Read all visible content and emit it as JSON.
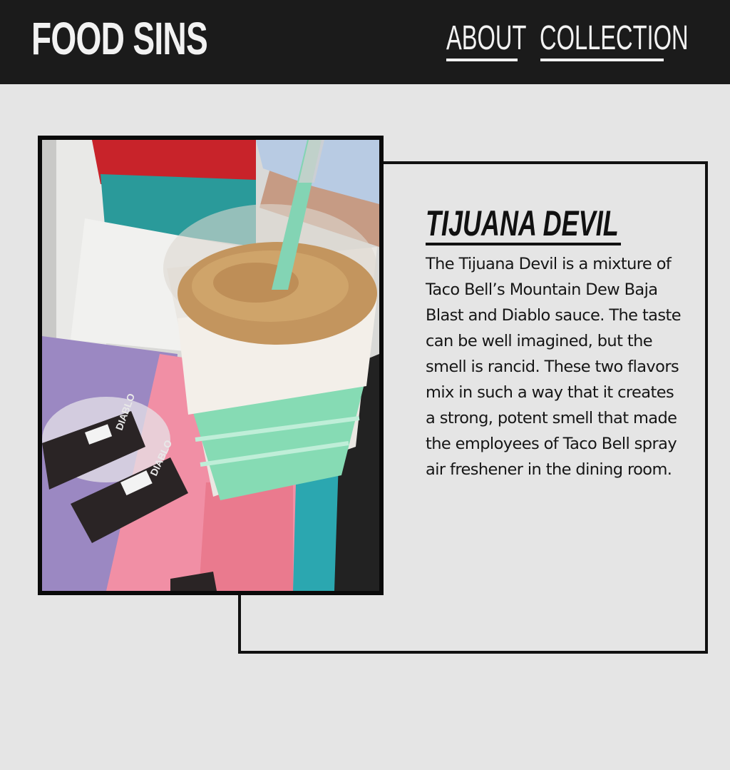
{
  "header": {
    "logo": "FOOD SINS",
    "nav": [
      {
        "label": "ABOUT"
      },
      {
        "label": "COLLECTION"
      }
    ]
  },
  "item": {
    "title": "TIJUANA DEVIL",
    "description": "The Tijuana Devil is a mix­ture of Taco Bell’s Mountain Dew Baja Blast and Diablo sauce. The taste can be well imagined, but the smell is rancid. These two flavors mix in such a way that it creates a strong, potent smell that made the em­ployees of Taco Bell spray air freshener in the dining room.",
    "photo": {
      "subject": "Tijuana Devil drink in a clear cup with a green straw next to Diablo sauce packets",
      "packet_label": "DIABLO"
    }
  },
  "colors": {
    "header_bg": "#1b1b1b",
    "page_bg": "#e5e5e5",
    "text": "#111111",
    "header_text": "#f2f2f2"
  }
}
